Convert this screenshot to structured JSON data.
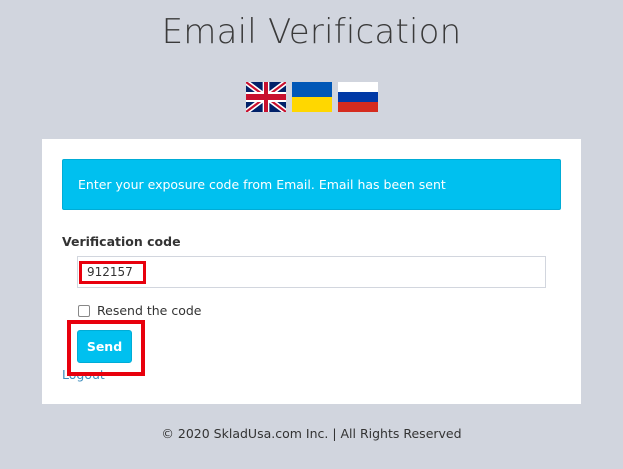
{
  "header": {
    "title": "Email Verification"
  },
  "languages": [
    {
      "name": "english",
      "icon": "uk-flag-icon"
    },
    {
      "name": "ukrainian",
      "icon": "ukraine-flag-icon"
    },
    {
      "name": "russian",
      "icon": "russia-flag-icon"
    }
  ],
  "alert": {
    "message": "Enter your exposure code from Email. Email has been sent",
    "color": "#00c0ef"
  },
  "form": {
    "label": "Verification code",
    "code_value": "912157",
    "resend_label": "Resend the code",
    "resend_checked": false,
    "send_label": "Send",
    "logout_label": "Logout"
  },
  "colors": {
    "accent": "#00c0ef",
    "highlight": "#e8000d",
    "link": "#3c8dbc"
  },
  "footer": {
    "text": "© 2020 SkladUsa.com Inc. | All Rights Reserved"
  }
}
